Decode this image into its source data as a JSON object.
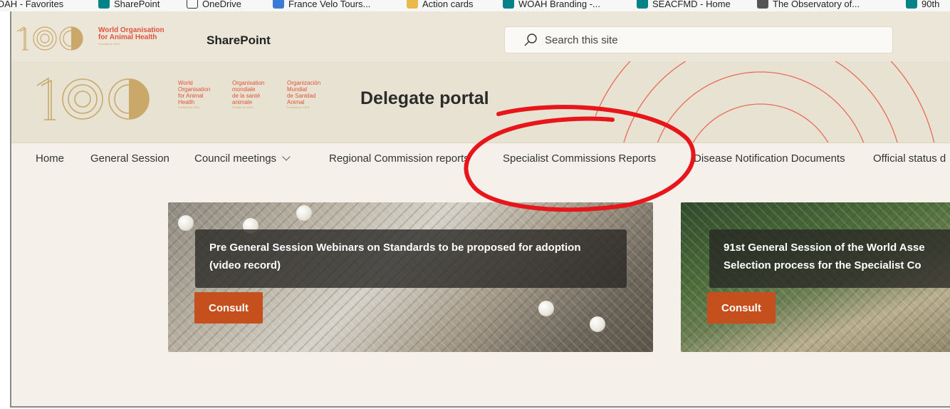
{
  "favorites": [
    {
      "label": "OAH - Favorites",
      "icon": "star-folder-icon"
    },
    {
      "label": "SharePoint",
      "icon": "sharepoint-icon"
    },
    {
      "label": "OneDrive",
      "icon": "onedrive-icon"
    },
    {
      "label": "France Velo Tours...",
      "icon": "website-icon"
    },
    {
      "label": "Action cards",
      "icon": "folder-icon"
    },
    {
      "label": "WOAH Branding -...",
      "icon": "sharepoint-icon"
    },
    {
      "label": "SEACFMD - Home",
      "icon": "sharepoint-icon"
    },
    {
      "label": "The Observatory of...",
      "icon": "website-icon"
    },
    {
      "label": "90th",
      "icon": "sharepoint-icon"
    }
  ],
  "suitebar": {
    "org_line1": "World Organisation",
    "org_line2": "for Animal Health",
    "founded": "Founded in 1924",
    "app_name": "SharePoint",
    "search_placeholder": "Search this site"
  },
  "hero": {
    "col_en": [
      "World",
      "Organisation",
      "for Animal",
      "Health"
    ],
    "col_fr": [
      "Organisation",
      "mondiale",
      "de la santé",
      "animale"
    ],
    "col_es": [
      "Organización",
      "Mundial",
      "de Sanidad",
      "Animal"
    ],
    "founded_en": "Founded in 1924",
    "founded_fr": "Fondée en 1924",
    "founded_es": "Fundada en 1924",
    "title": "Delegate portal"
  },
  "nav": {
    "items": [
      "Home",
      "General Session",
      "Council meetings",
      "Regional Commission reports",
      "Specialist Commissions Reports",
      "Disease Notification Documents",
      "Official status d"
    ]
  },
  "cards": [
    {
      "title": "Pre General Session Webinars on Standards to be proposed for adoption (video record)",
      "button": "Consult"
    },
    {
      "title_line1": "91st General Session of the World Asse",
      "title_line2": "Selection process for the Specialist Co",
      "button": "Consult"
    }
  ],
  "colors": {
    "accent": "#c5501e",
    "annotation": "#e8151b",
    "brand_orange": "#e0533a",
    "brand_gold": "#c9a86a"
  }
}
